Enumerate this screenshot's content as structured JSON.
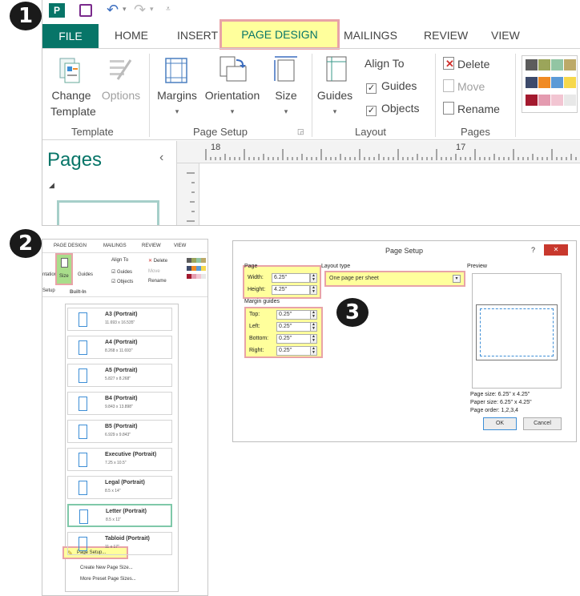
{
  "badges": {
    "b1": "1",
    "b2": "2",
    "b3": "3"
  },
  "ribbon": {
    "qat_app": "P",
    "tabs": {
      "file": "FILE",
      "home": "HOME",
      "insert": "INSERT",
      "page_design": "PAGE DESIGN",
      "mailings": "MAILINGS",
      "review": "REVIEW",
      "view": "VIEW"
    },
    "template": {
      "change": "Change",
      "template": "Template",
      "options": "Options",
      "group": "Template"
    },
    "page_setup": {
      "margins": "Margins",
      "orientation": "Orientation",
      "size": "Size",
      "group": "Page Setup"
    },
    "layout": {
      "guides": "Guides",
      "align_to": "Align To",
      "guides_chk": "Guides",
      "objects_chk": "Objects",
      "group": "Layout"
    },
    "pages": {
      "delete": "Delete",
      "move": "Move",
      "rename": "Rename",
      "group": "Pages"
    },
    "swatch_colors": [
      [
        "#5c5c5c",
        "#9ba55a",
        "#92c5a3",
        "#bca968"
      ],
      [
        "#3d4a6b",
        "#f08a24",
        "#5c9ad6",
        "#f6d84c"
      ],
      [
        "#a3192e",
        "#e49bb0",
        "#f2c5d2",
        "#e8e8e8"
      ]
    ],
    "pages_pane": {
      "title": "Pages",
      "collapse": "‹"
    },
    "ruler": {
      "left_num": "18",
      "right_num": "17"
    }
  },
  "size_menu": {
    "tabs": {
      "page_design": "PAGE DESIGN",
      "mailings": "MAILINGS",
      "review": "REVIEW",
      "view": "VIEW"
    },
    "buttons": {
      "orientation": "ntation",
      "size": "Size",
      "guides": "Guides",
      "align_to": "Align To",
      "guides_chk": "Guides",
      "objects_chk": "Objects",
      "delete": "Delete",
      "move": "Move",
      "rename": "Rename",
      "setup": "Setup",
      "built_in": "Built-In"
    },
    "options": [
      {
        "title": "A3 (Portrait)",
        "size": "11.693 x 16.535\""
      },
      {
        "title": "A4 (Portrait)",
        "size": "8.268 x 11.693\""
      },
      {
        "title": "A5 (Portrait)",
        "size": "5.827 x 8.268\""
      },
      {
        "title": "B4 (Portrait)",
        "size": "9.843 x 13.898\""
      },
      {
        "title": "B5 (Portrait)",
        "size": "6.929 x 9.843\""
      },
      {
        "title": "Executive (Portrait)",
        "size": "7.25 x 10.5\""
      },
      {
        "title": "Legal (Portrait)",
        "size": "8.5 x 14\""
      },
      {
        "title": "Letter (Portrait)",
        "size": "8.5 x 11\""
      },
      {
        "title": "Tabloid (Portrait)",
        "size": "11 x 17\""
      }
    ],
    "page_setup_link": "Page Setup...",
    "create_new": "Create New Page Size...",
    "more_preset": "More Preset Page Sizes..."
  },
  "dialog": {
    "title": "Page Setup",
    "help": "?",
    "close": "✕",
    "page_section": "Page",
    "width_label": "Width:",
    "width_value": "6.25\"",
    "height_label": "Height:",
    "height_value": "4.25\"",
    "margin_section": "Margin guides",
    "top_label": "Top:",
    "top_value": "0.25\"",
    "left_label": "Left:",
    "left_value": "0.25\"",
    "bottom_label": "Bottom:",
    "bottom_value": "0.25\"",
    "right_label": "Right:",
    "right_value": "0.25\"",
    "layout_section": "Layout type",
    "layout_value": "One page per sheet",
    "preview_section": "Preview",
    "page_size": "Page size: 6.25\" x 4.25\"",
    "paper_size": "Paper size: 6.25\" x 4.25\"",
    "page_order": "Page order: 1,2,3,4",
    "ok": "OK",
    "cancel": "Cancel"
  }
}
